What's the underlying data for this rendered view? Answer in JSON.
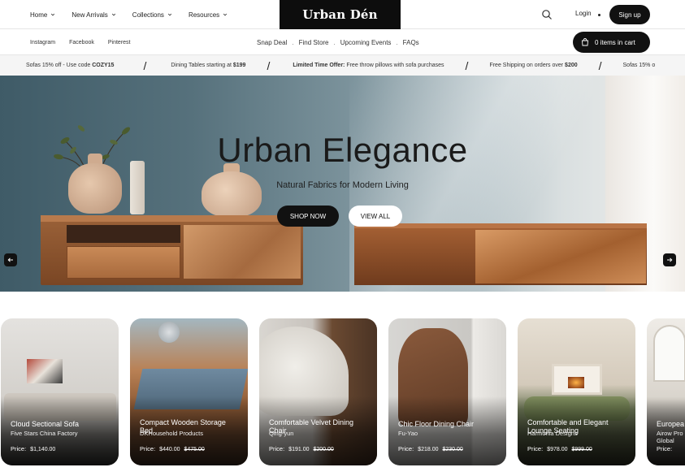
{
  "nav": {
    "items": [
      {
        "label": "Home"
      },
      {
        "label": "New Arrivals"
      },
      {
        "label": "Collections"
      },
      {
        "label": "Resources"
      }
    ],
    "logo": "Urban Dén",
    "login": "Login",
    "signup": "Sign up"
  },
  "subnav": {
    "social": [
      "Instagram",
      "Facebook",
      "Pinterest"
    ],
    "links": [
      "Snap Deal",
      "Find Store",
      "Upcoming Events",
      "FAQs"
    ],
    "cart": "0 items in cart"
  },
  "ticker": {
    "items": [
      {
        "pre": "Sofas 15% off - Use code ",
        "bold": "COZY15",
        "post": ""
      },
      {
        "pre": "Dining Tables starting at ",
        "bold": "$199",
        "post": ""
      },
      {
        "pre": "",
        "bold": "Limited Time Offer:",
        "post": " Free throw pillows with sofa purchases"
      },
      {
        "pre": "Free Shipping on orders over ",
        "bold": "$200",
        "post": ""
      },
      {
        "pre": "Sofas 15% o",
        "bold": "",
        "post": ""
      }
    ]
  },
  "hero": {
    "title": "Urban Elegance",
    "subtitle": "Natural Fabrics for Modern Living",
    "shop_now": "SHOP NOW",
    "view_all": "VIEW ALL"
  },
  "products": [
    {
      "name": "Cloud Sectional Sofa",
      "brand": "Five Stars China Factory",
      "price_label": "Price:",
      "price": "$1,140.00",
      "old_price": ""
    },
    {
      "name": "Compact Wooden Storage Bed",
      "brand": "DKHousehold Products",
      "price_label": "Price:",
      "price": "$440.00",
      "old_price": "$475.00"
    },
    {
      "name": "Comfortable Velvet Dining Chair",
      "brand": "Qing-yun",
      "price_label": "Price:",
      "price": "$191.00",
      "old_price": "$200.00"
    },
    {
      "name": "Chic Floor Dining Chair",
      "brand": "Fu-Yao",
      "price_label": "Price:",
      "price": "$218.00",
      "old_price": "$230.00"
    },
    {
      "name": "Comfortable and Elegant Lounge Seating",
      "brand": "Harmonia Designs",
      "price_label": "Price:",
      "price": "$978.00",
      "old_price": "$999.00"
    },
    {
      "name": "Europea",
      "brand": "Airow Pro Global",
      "price_label": "Price:",
      "price": "",
      "old_price": ""
    }
  ],
  "colors": {
    "primary": "#111111",
    "hero_wall": "#56717c",
    "wood": "#9b6239"
  }
}
